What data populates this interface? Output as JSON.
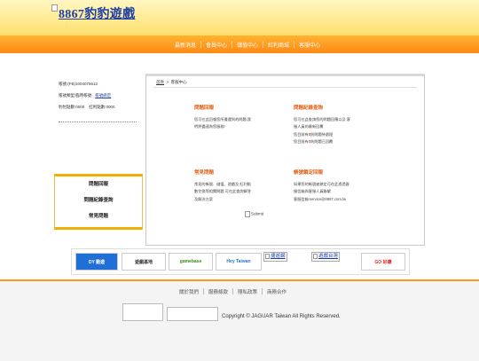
{
  "header": {
    "logo_text": "8867豹豹遊戲",
    "nav": [
      "最新消息",
      "會員中心",
      "儲值中心",
      "紅利商城",
      "客服中心"
    ]
  },
  "user_panel": {
    "account": "帳號:(FB)1004075612",
    "account_type_label": "帳號類型:臨時帳號",
    "upgrade_link": "帳號綁定",
    "points": "豹豹點數:0000",
    "bonus": "紅利點數:0000"
  },
  "sidebar": {
    "items": [
      "問題回報",
      "問題紀錄查詢",
      "常見問題"
    ]
  },
  "breadcrumb": {
    "home": "首頁",
    "separator": ">",
    "current": "客服中心"
  },
  "sections": {
    "report": {
      "title": "問題回報",
      "line1": "您可在此回報您所遭遇到的問題,我",
      "line2": "們將儘速為您服務!"
    },
    "history": {
      "title": "問題紀錄查詢",
      "line1": "您可在此查詢您的問題回應以及 客",
      "line2": "服人員的最新回覆",
      "line3_pre": "您目前有",
      "line3_num": "0",
      "line3_post": "則問題待處理",
      "line4_pre": "您目前有",
      "line4_num": "0",
      "line4_post": "則問題已回覆"
    },
    "faq": {
      "title": "常見問題",
      "line1": "常見的帳號、儲值、遊戲及 紅利點",
      "line2": "數兌換等相關問題 可在此查詢解答",
      "line3": "及解決方案",
      "submit_alt": "Submit"
    },
    "unlock": {
      "title": "帳號鎖定回報",
      "line1": "如果您的帳號被鎖定可在此透過客",
      "line2": "服信箱與客服人員聯繫",
      "line3": "客服信箱:service@8867.com.tw"
    }
  },
  "partners": {
    "items": [
      "DY 動遊",
      "遊戲基地",
      "gamebase",
      "Hey Taiwan",
      "捷遊網",
      "遊戲台灣",
      "GO 好康"
    ]
  },
  "footer": {
    "links": [
      "關於我們",
      "服務條款",
      "隱私政策",
      "商務合作"
    ],
    "copyright": "Copyright © JAGUAR Taiwan All Rights Reserved."
  },
  "colors": {
    "orange_bar": "#ff8a14",
    "header_yellow": "#ffe889",
    "section_title": "#e45f10",
    "link_blue": "#1d3fa5"
  }
}
